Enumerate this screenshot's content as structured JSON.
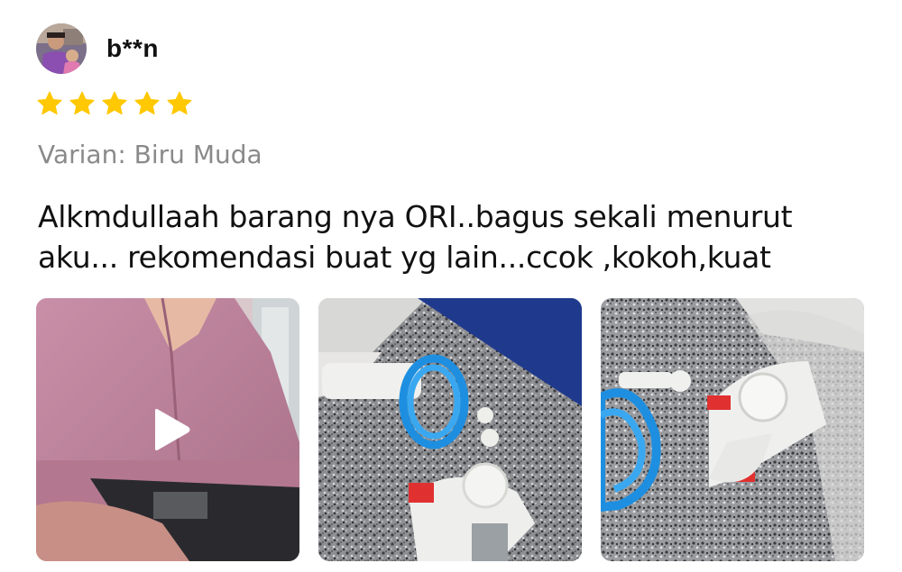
{
  "review": {
    "username": "b**n",
    "avatar": "avatar-photo",
    "rating": 5,
    "rating_max": 5,
    "star_color": "#FFC800",
    "variant_label": "Varian: Biru Muda",
    "text_lines": [
      "Alkmdullaah barang nya ORI..bagus sekali menurut",
      "aku... rekomendasi buat yg lain...ccok ,kokoh,kuat"
    ],
    "media": [
      {
        "type": "video",
        "icon": "play-icon"
      },
      {
        "type": "photo"
      },
      {
        "type": "photo"
      }
    ]
  }
}
